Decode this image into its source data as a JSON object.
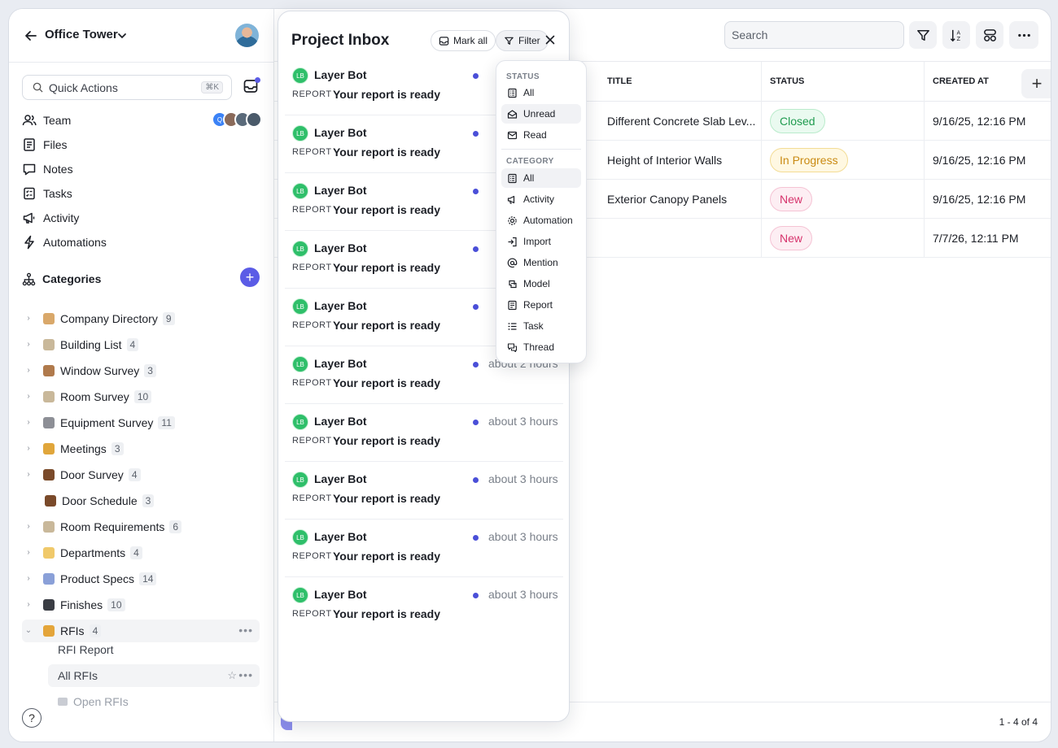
{
  "sidebar": {
    "project_title": "Office Tower",
    "quick_actions": {
      "label": "Quick Actions",
      "shortcut": "⌘K"
    },
    "nav": [
      {
        "label": "Team",
        "icon": "team-icon"
      },
      {
        "label": "Files",
        "icon": "files-icon"
      },
      {
        "label": "Notes",
        "icon": "notes-icon"
      },
      {
        "label": "Tasks",
        "icon": "tasks-icon"
      },
      {
        "label": "Activity",
        "icon": "megaphone-icon"
      },
      {
        "label": "Automations",
        "icon": "bolt-icon"
      }
    ],
    "categories_title": "Categories",
    "categories": [
      {
        "label": "Company Directory",
        "count": "9",
        "color": "#d9a86a"
      },
      {
        "label": "Building List",
        "count": "4",
        "color": "#c9b89a"
      },
      {
        "label": "Window Survey",
        "count": "3",
        "color": "#b07a4c"
      },
      {
        "label": "Room Survey",
        "count": "10",
        "color": "#c9b89a"
      },
      {
        "label": "Equipment Survey",
        "count": "11",
        "color": "#8d8f96"
      },
      {
        "label": "Meetings",
        "count": "3",
        "color": "#e0a63b"
      },
      {
        "label": "Door Survey",
        "count": "4",
        "color": "#7a4a2a"
      },
      {
        "label": "Door Schedule",
        "count": "3",
        "color": "#7a4a2a"
      },
      {
        "label": "Room Requirements",
        "count": "6",
        "color": "#c9b89a"
      },
      {
        "label": "Departments",
        "count": "4",
        "color": "#f0c96a"
      },
      {
        "label": "Product Specs",
        "count": "14",
        "color": "#8aa0d8"
      },
      {
        "label": "Finishes",
        "count": "10",
        "color": "#3a3d44"
      },
      {
        "label": "RFIs",
        "count": "4",
        "color": "#e4a53a"
      }
    ],
    "rfi_children": [
      "RFI Report",
      "All RFIs",
      "Open RFIs"
    ],
    "help": "?"
  },
  "toolbar": {
    "search_placeholder": "Search"
  },
  "table": {
    "columns": [
      "TITLE",
      "STATUS",
      "CREATED AT"
    ],
    "rows": [
      {
        "title": "Different Concrete Slab Lev...",
        "status": "Closed",
        "created": "9/16/25, 12:16 PM"
      },
      {
        "title": "Height of Interior Walls",
        "status": "In Progress",
        "created": "9/16/25, 12:16 PM"
      },
      {
        "title": "Exterior Canopy Panels",
        "status": "New",
        "created": "9/16/25, 12:16 PM"
      },
      {
        "title": "",
        "status": "New",
        "created": "7/7/26, 12:11 PM"
      }
    ],
    "pager": "1 - 4 of 4"
  },
  "status_colors": {
    "Closed": {
      "fg": "#1f9b4f",
      "bg": "#eafaf0",
      "border": "#b9ebcb"
    },
    "In Progress": {
      "fg": "#c98a12",
      "bg": "#fff8e2",
      "border": "#f3dc95"
    },
    "New": {
      "fg": "#d6336c",
      "bg": "#fdeef3",
      "border": "#f5c3d4"
    }
  },
  "inbox": {
    "title": "Project Inbox",
    "mark_all": "Mark all",
    "filter": "Filter",
    "messages": [
      {
        "sender": "Layer Bot",
        "avatar": "LB",
        "category": "REPORT",
        "text": "Your report is ready",
        "time": ""
      },
      {
        "sender": "Layer Bot",
        "avatar": "LB",
        "category": "REPORT",
        "text": "Your report is ready",
        "time": ""
      },
      {
        "sender": "Layer Bot",
        "avatar": "LB",
        "category": "REPORT",
        "text": "Your report is ready",
        "time": ""
      },
      {
        "sender": "Layer Bot",
        "avatar": "LB",
        "category": "REPORT",
        "text": "Your report is ready",
        "time": ""
      },
      {
        "sender": "Layer Bot",
        "avatar": "LB",
        "category": "REPORT",
        "text": "Your report is ready",
        "time": ""
      },
      {
        "sender": "Layer Bot",
        "avatar": "LB",
        "category": "REPORT",
        "text": "Your report is ready",
        "time": "about 2 hours"
      },
      {
        "sender": "Layer Bot",
        "avatar": "LB",
        "category": "REPORT",
        "text": "Your report is ready",
        "time": "about 3 hours"
      },
      {
        "sender": "Layer Bot",
        "avatar": "LB",
        "category": "REPORT",
        "text": "Your report is ready",
        "time": "about 3 hours"
      },
      {
        "sender": "Layer Bot",
        "avatar": "LB",
        "category": "REPORT",
        "text": "Your report is ready",
        "time": "about 3 hours"
      },
      {
        "sender": "Layer Bot",
        "avatar": "LB",
        "category": "REPORT",
        "text": "Your report is ready",
        "time": "about 3 hours"
      }
    ]
  },
  "filter_menu": {
    "status_title": "STATUS",
    "status_options": [
      {
        "label": "All",
        "icon": "list-icon"
      },
      {
        "label": "Unread",
        "icon": "envelope-open-icon",
        "highlighted": true
      },
      {
        "label": "Read",
        "icon": "envelope-icon"
      }
    ],
    "category_title": "CATEGORY",
    "category_options": [
      {
        "label": "All",
        "icon": "list-icon",
        "highlighted": true
      },
      {
        "label": "Activity",
        "icon": "megaphone-icon"
      },
      {
        "label": "Automation",
        "icon": "gear-icon"
      },
      {
        "label": "Import",
        "icon": "import-icon"
      },
      {
        "label": "Mention",
        "icon": "at-icon"
      },
      {
        "label": "Model",
        "icon": "model-icon"
      },
      {
        "label": "Report",
        "icon": "report-icon"
      },
      {
        "label": "Task",
        "icon": "task-list-icon"
      },
      {
        "label": "Thread",
        "icon": "thread-icon"
      }
    ]
  },
  "accent": "#5b5ce6"
}
